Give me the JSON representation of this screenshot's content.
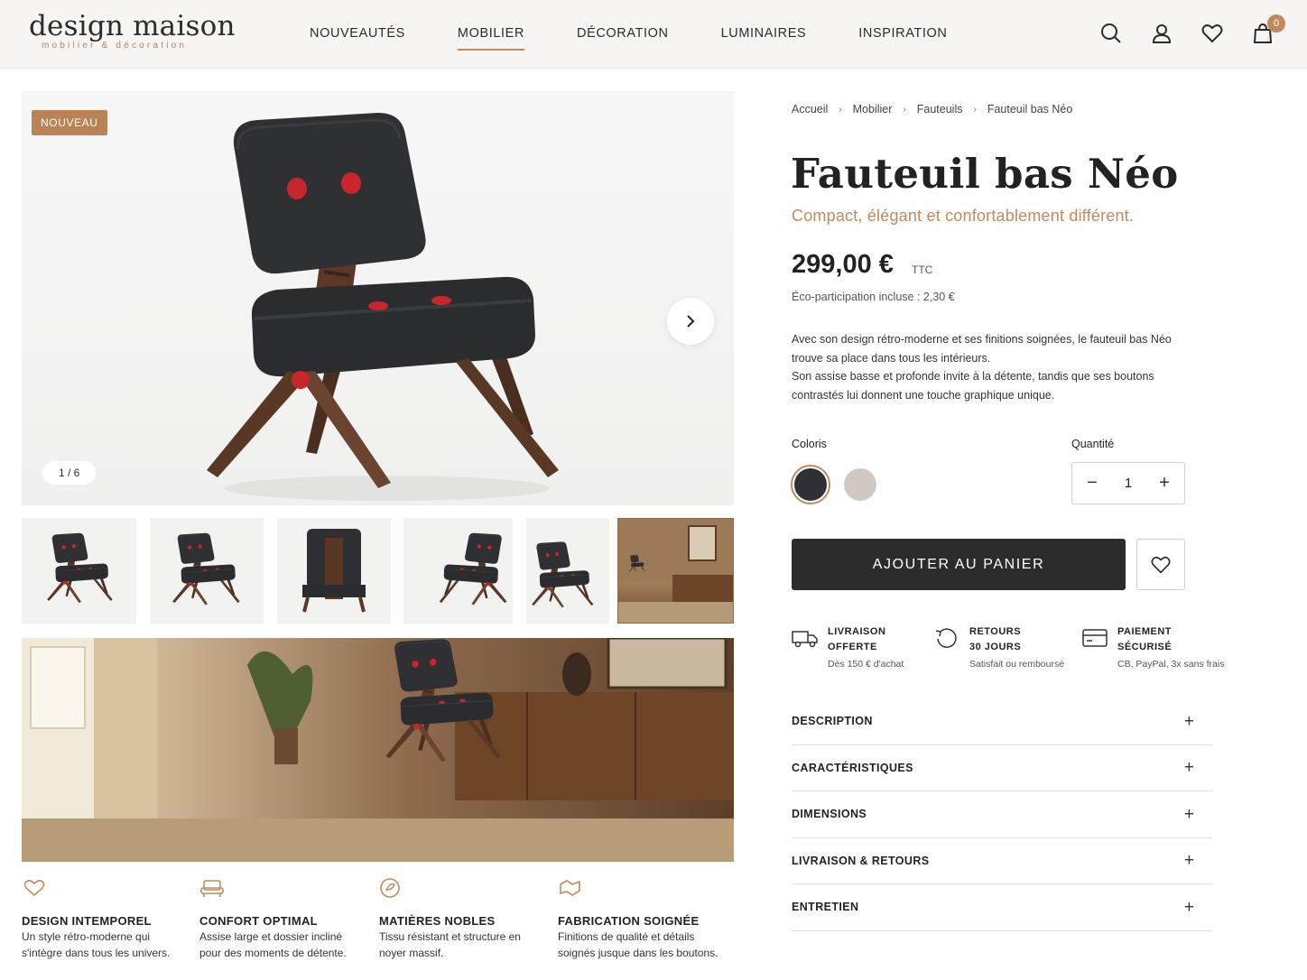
{
  "brand": {
    "name": "design maison",
    "tagline": "mobilier & décoration"
  },
  "nav": {
    "items": [
      "NOUVEAUTÉS",
      "MOBILIER",
      "DÉCORATION",
      "LUMINAIRES",
      "INSPIRATION"
    ],
    "active": "MOBILIER"
  },
  "header": {
    "cart_count": "0",
    "icons": [
      "search-icon",
      "account-icon",
      "heart-icon",
      "bag-icon"
    ]
  },
  "gallery": {
    "badge": "NOUVEAU",
    "counter": "1 / 6",
    "thumbnail_count": 6
  },
  "features": [
    {
      "icon": "heart-hand-icon",
      "title": "DESIGN INTEMPOREL",
      "text_1": "Un style rétro-moderne qui",
      "text_2": "s'intègre dans tous les univers."
    },
    {
      "icon": "armchair-icon",
      "title": "CONFORT OPTIMAL",
      "text_1": "Assise large et dossier incliné",
      "text_2": "pour des moments de détente."
    },
    {
      "icon": "leaf-icon",
      "title": "MATIÈRES NOBLES",
      "text_1": "Tissu résistant et structure en",
      "text_2": "noyer massif."
    },
    {
      "icon": "craft-icon",
      "title": "FABRICATION SOIGNÉE",
      "text_1": "Finitions de qualité et détails",
      "text_2": "soignés jusque dans les boutons."
    }
  ],
  "breadcrumb": [
    "Accueil",
    "Mobilier",
    "Fauteuils",
    "Fauteuil bas Néo"
  ],
  "product": {
    "title": "Fauteuil bas Néo",
    "subtitle": "Compact, élégant et confortablement différent.",
    "price": "299,00 €",
    "price_suffix": "TTC",
    "eco": "Éco-participation incluse : 2,30 €",
    "description_1": "Avec son design rétro-moderne et ses finitions soignées, le fauteuil bas Néo",
    "description_2": "trouve sa place dans tous les intérieurs.",
    "description_3": "Son assise basse et profonde invite à la détente, tandis que ses boutons",
    "description_4": "contrastés lui donnent une touche graphique unique."
  },
  "options": {
    "coloris_label": "Coloris",
    "colors": [
      "#2e3036",
      "#cfc9c2"
    ],
    "selected_color": 0,
    "quantity_label": "Quantité",
    "quantity": "1",
    "accent": "#c28a5c"
  },
  "actions": {
    "add_to_cart": "AJOUTER AU PANIER"
  },
  "perks": [
    {
      "icon": "truck-icon",
      "title_1": "LIVRAISON",
      "title_2": "OFFERTE",
      "sub": "Dès 150 € d'achat"
    },
    {
      "icon": "return-icon",
      "title_1": "RETOURS",
      "title_2": "30 JOURS",
      "sub": "Satisfait ou remboursé"
    },
    {
      "icon": "card-icon",
      "title_1": "PAIEMENT",
      "title_2": "SÉCURISÉ",
      "sub": "CB, PayPal, 3x sans frais"
    }
  ],
  "accordion": [
    "DESCRIPTION",
    "CARACTÉRISTIQUES",
    "DIMENSIONS",
    "LIVRAISON & RETOURS",
    "ENTRETIEN"
  ]
}
